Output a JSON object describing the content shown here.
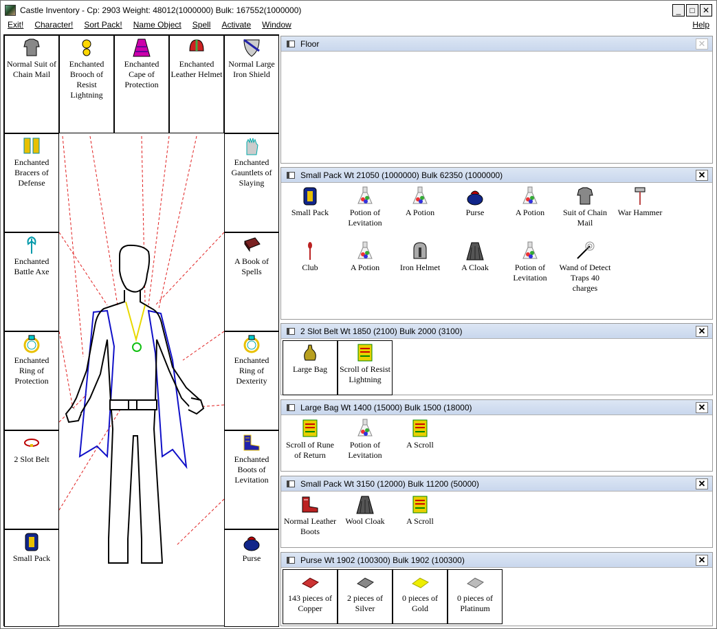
{
  "window": {
    "title": "Castle Inventory - Cp: 2903 Weight: 48012(1000000) Bulk: 167552(1000000)",
    "minimize": "_",
    "maximize": "□",
    "close": "✕"
  },
  "menu": {
    "items": [
      "Exit!",
      "Character!",
      "Sort Pack!",
      "Name Object",
      "Spell",
      "Activate",
      "Window"
    ],
    "help": "Help"
  },
  "doll": {
    "slots": [
      {
        "label": "Normal Suit of Chain Mail",
        "icon": "chain-mail-icon"
      },
      {
        "label": "Enchanted Brooch of Resist Lightning",
        "icon": "brooch-icon"
      },
      {
        "label": "Enchanted Cape of Protection",
        "icon": "cape-icon"
      },
      {
        "label": "Enchanted Leather Helmet",
        "icon": "leather-helmet-icon"
      },
      {
        "label": "Normal Large Iron Shield",
        "icon": "shield-icon"
      },
      {
        "label": "Enchanted Bracers of Defense",
        "icon": "bracers-icon"
      },
      {
        "label": "Enchanted Gauntlets of Slaying",
        "icon": "gauntlets-icon"
      },
      {
        "label": "Enchanted Battle Axe",
        "icon": "battle-axe-icon"
      },
      {
        "label": "A Book of Spells",
        "icon": "spellbook-icon"
      },
      {
        "label": "Enchanted Ring of Protection",
        "icon": "ring-icon"
      },
      {
        "label": "Enchanted Ring of Dexterity",
        "icon": "ring-icon"
      },
      {
        "label": "2 Slot Belt",
        "icon": "belt-icon"
      },
      {
        "label": "Enchanted Boots of Levitation",
        "icon": "boots-icon"
      },
      {
        "label": "Small Pack",
        "icon": "pack-icon"
      },
      {
        "label": "Purse",
        "icon": "purse-icon"
      }
    ]
  },
  "panels": {
    "floor": {
      "title": "Floor",
      "close": "✕"
    },
    "small_pack_1": {
      "title": "Small Pack Wt 21050 (1000000) Bulk 62350 (1000000)",
      "close": "✕",
      "items": [
        {
          "label": "Small Pack",
          "icon": "pack-icon"
        },
        {
          "label": "Potion of Levitation",
          "icon": "potion-icon"
        },
        {
          "label": "A Potion",
          "icon": "potion-icon"
        },
        {
          "label": "Purse",
          "icon": "purse-icon"
        },
        {
          "label": "A Potion",
          "icon": "potion-icon"
        },
        {
          "label": "Suit of Chain Mail",
          "icon": "chain-mail-icon"
        },
        {
          "label": "War Hammer",
          "icon": "war-hammer-icon"
        },
        {
          "label": "Club",
          "icon": "club-icon"
        },
        {
          "label": "A Potion",
          "icon": "potion-icon"
        },
        {
          "label": "Iron Helmet",
          "icon": "iron-helmet-icon"
        },
        {
          "label": "A Cloak",
          "icon": "cloak-icon"
        },
        {
          "label": "Potion of Levitation",
          "icon": "potion-icon"
        },
        {
          "label": "Wand of Detect Traps 40 charges",
          "icon": "wand-icon"
        }
      ]
    },
    "belt": {
      "title": "2 Slot Belt Wt 1850 (2100) Bulk 2000 (3100)",
      "close": "✕",
      "items": [
        {
          "label": "Large Bag",
          "icon": "bag-icon"
        },
        {
          "label": "Scroll of Resist Lightning",
          "icon": "scroll-icon"
        }
      ]
    },
    "large_bag": {
      "title": "Large Bag Wt 1400 (15000) Bulk 1500 (18000)",
      "close": "✕",
      "items": [
        {
          "label": "Scroll of Rune of Return",
          "icon": "scroll-icon"
        },
        {
          "label": "Potion of Levitation",
          "icon": "potion-icon"
        },
        {
          "label": "A Scroll",
          "icon": "scroll-icon"
        }
      ]
    },
    "small_pack_2": {
      "title": "Small Pack Wt 3150 (12000) Bulk 11200 (50000)",
      "close": "✕",
      "items": [
        {
          "label": "Normal Leather Boots",
          "icon": "boots-icon"
        },
        {
          "label": "Wool Cloak",
          "icon": "cloak-icon"
        },
        {
          "label": "A Scroll",
          "icon": "scroll-icon"
        }
      ]
    },
    "purse": {
      "title": "Purse Wt 1902 (100300) Bulk 1902 (100300)",
      "close": "✕",
      "items": [
        {
          "label": "143 pieces of Copper",
          "icon": "coins-copper-icon"
        },
        {
          "label": "2 pieces of Silver",
          "icon": "coins-silver-icon"
        },
        {
          "label": "0 pieces of Gold",
          "icon": "coins-gold-icon"
        },
        {
          "label": "0 pieces of Platinum",
          "icon": "coins-platinum-icon"
        }
      ]
    }
  },
  "colors": {
    "panel_header": "#c9d7ed",
    "guide_line": "#e02020",
    "cape": "#1010c8",
    "necklace_chain": "#e8d800",
    "amulet": "#10c010"
  }
}
